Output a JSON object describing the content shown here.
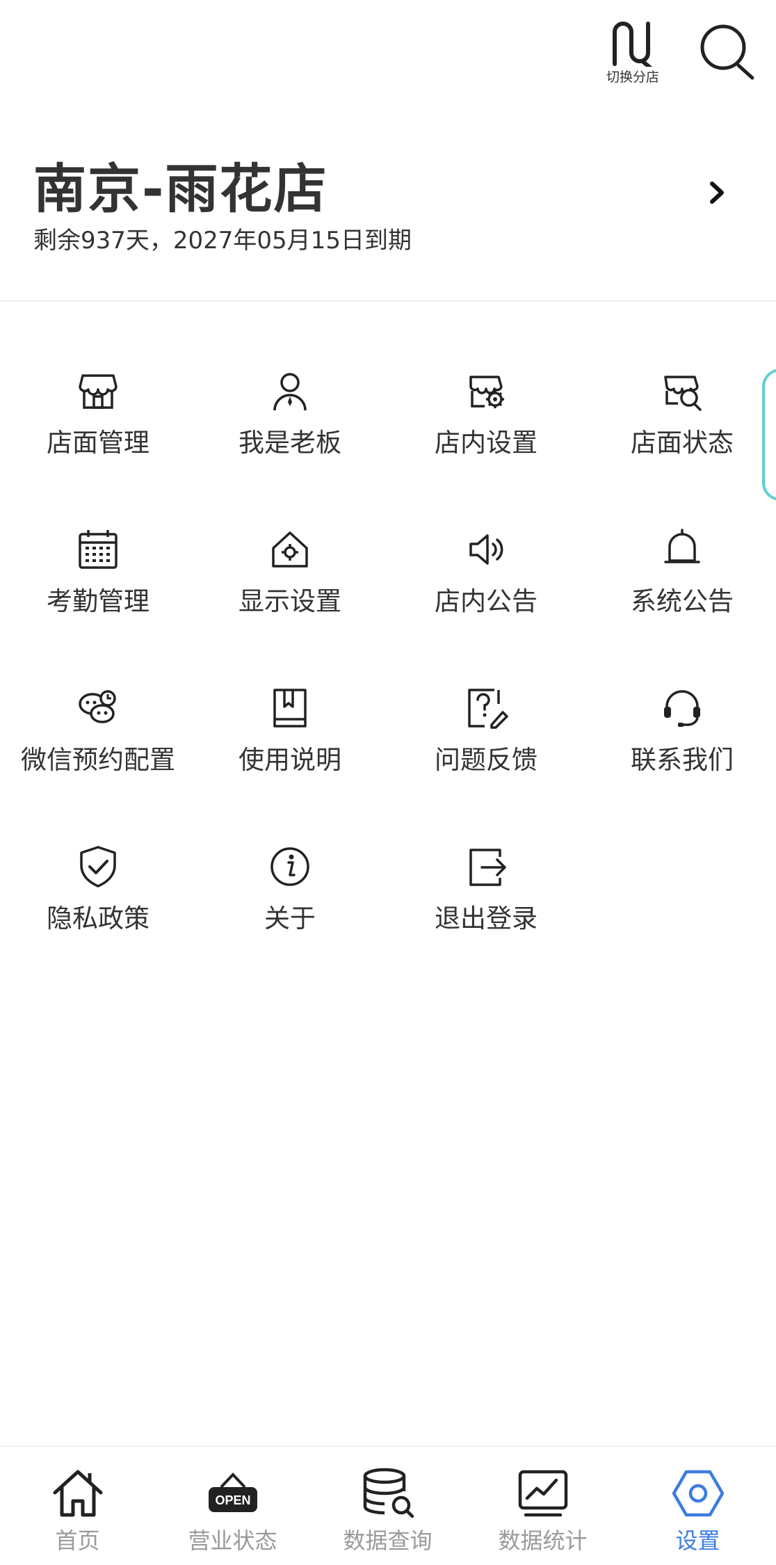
{
  "topbar": {
    "switch_label": "切换分店",
    "switch_icon": "switch-store-icon",
    "search_icon": "search-icon"
  },
  "store": {
    "name": "南京-雨花店",
    "expiry": "剩余937天，2027年05月15日到期"
  },
  "menu": {
    "items": [
      {
        "label": "店面管理",
        "icon": "storefront-icon"
      },
      {
        "label": "我是老板",
        "icon": "person-icon"
      },
      {
        "label": "店内设置",
        "icon": "store-gear-icon"
      },
      {
        "label": "店面状态",
        "icon": "store-search-icon"
      },
      {
        "label": "考勤管理",
        "icon": "calendar-icon"
      },
      {
        "label": "显示设置",
        "icon": "home-gear-icon"
      },
      {
        "label": "店内公告",
        "icon": "speaker-icon"
      },
      {
        "label": "系统公告",
        "icon": "bell-icon"
      },
      {
        "label": "微信预约配置",
        "icon": "chat-clock-icon"
      },
      {
        "label": "使用说明",
        "icon": "book-icon"
      },
      {
        "label": "问题反馈",
        "icon": "question-edit-icon"
      },
      {
        "label": "联系我们",
        "icon": "headset-icon"
      },
      {
        "label": "隐私政策",
        "icon": "shield-check-icon"
      },
      {
        "label": "关于",
        "icon": "info-icon"
      },
      {
        "label": "退出登录",
        "icon": "logout-icon"
      }
    ]
  },
  "nav": {
    "items": [
      {
        "label": "首页",
        "icon": "home-icon"
      },
      {
        "label": "营业状态",
        "icon": "open-sign-icon",
        "sign_text": "OPEN"
      },
      {
        "label": "数据查询",
        "icon": "database-search-icon"
      },
      {
        "label": "数据统计",
        "icon": "chart-icon"
      },
      {
        "label": "设置",
        "icon": "settings-hexagon-icon"
      }
    ],
    "active_color": "#3d7ce0",
    "inactive_color": "#9a9a9a"
  },
  "colors": {
    "text": "#333333",
    "side_tab": "#5fd0d0"
  }
}
